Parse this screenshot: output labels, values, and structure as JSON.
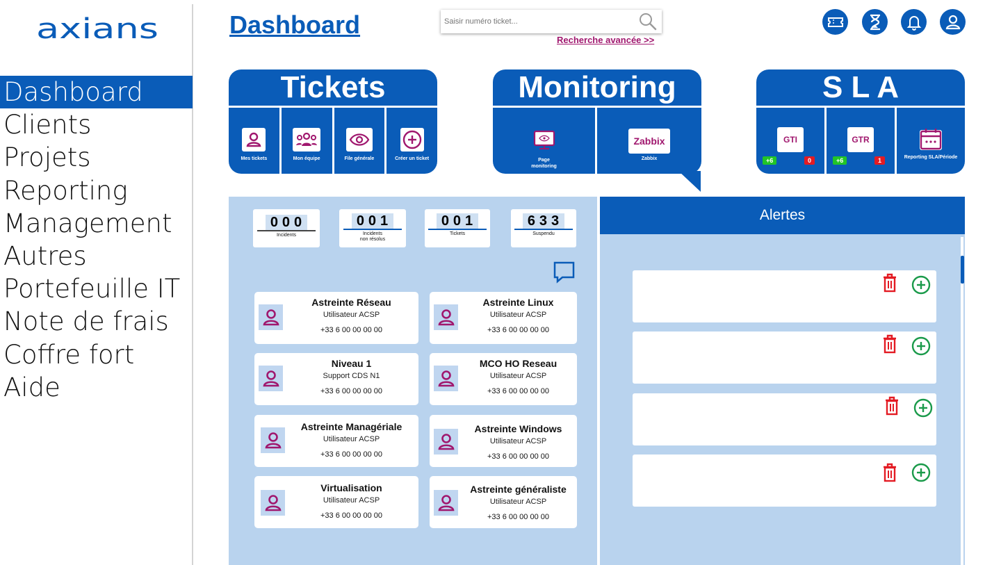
{
  "brand": {
    "logo_text": "axians",
    "primary_color": "#0a5cb8",
    "accent_color": "#a0176e"
  },
  "sidebar": {
    "items": [
      {
        "label": "Dashboard",
        "active": true
      },
      {
        "label": "Clients"
      },
      {
        "label": "Projets"
      },
      {
        "label": "Reporting"
      },
      {
        "label": "Management"
      },
      {
        "label": "Autres"
      },
      {
        "label": "Portefeuille IT"
      },
      {
        "label": "Note de frais"
      },
      {
        "label": "Coffre fort"
      },
      {
        "label": "Aide"
      }
    ]
  },
  "header": {
    "title": "Dashboard",
    "search_placeholder": "Saisir numéro ticket...",
    "advanced_search": "Recherche avancée >>",
    "icons": [
      "ticket-icon",
      "hourglass-icon",
      "bell-icon",
      "user-icon"
    ]
  },
  "tickets": {
    "title": "Tickets",
    "tiles": [
      {
        "label": "Mes tickets",
        "icon": "user-icon"
      },
      {
        "label": "Mon équipe",
        "icon": "team-icon"
      },
      {
        "label": "File générale",
        "icon": "eye-icon"
      },
      {
        "label": "Créer un ticket",
        "icon": "plus-circle-icon"
      }
    ]
  },
  "monitoring": {
    "title": "Monitoring",
    "tiles": [
      {
        "label": "Page\nmonitoring",
        "icon": "monitor-icon"
      },
      {
        "label": "Zabbix",
        "button": "Zabbix"
      }
    ]
  },
  "sla": {
    "title": "S L A",
    "tiles": [
      {
        "label": "",
        "button": "GTI",
        "badge_green": "+6",
        "badge_red": "0"
      },
      {
        "label": "",
        "button": "GTR",
        "badge_green": "+6",
        "badge_red": "1"
      },
      {
        "label": "Reporting SLA/Période",
        "icon": "calendar-icon"
      }
    ]
  },
  "counters": [
    {
      "value": "000",
      "label": "Incidents",
      "line_color": "#444444"
    },
    {
      "value": "001",
      "label": "Incidents\nnon résolus",
      "line_color": "#0a5cb8"
    },
    {
      "value": "001",
      "label": "Tickets",
      "line_color": "#0a5cb8"
    },
    {
      "value": "633",
      "label": "Suspendu",
      "line_color": "#0a5cb8"
    }
  ],
  "contacts": [
    {
      "name": "Astreinte Réseau",
      "role": "Utilisateur ACSP",
      "phone": "+33 6 00 00 00 00"
    },
    {
      "name": "Astreinte Linux",
      "role": "Utilisateur ACSP",
      "phone": "+33 6 00 00 00 00"
    },
    {
      "name": "Niveau 1",
      "role": "Support CDS N1",
      "phone": "+33 6 00 00 00 00"
    },
    {
      "name": "MCO HO Reseau",
      "role": "Utilisateur ACSP",
      "phone": "+33 6 00 00 00 00"
    },
    {
      "name": "Astreinte Managériale",
      "role": "Utilisateur ACSP",
      "phone": "+33 6 00 00 00 00"
    },
    {
      "name": "Astreinte Windows",
      "role": "Utilisateur ACSP",
      "phone": "+33 6 00 00 00 00"
    },
    {
      "name": "Virtualisation",
      "role": "Utilisateur ACSP",
      "phone": "+33 6 00 00 00 00"
    },
    {
      "name": "Astreinte généraliste",
      "role": "Utilisateur ACSP",
      "phone": "+33 6 00 00 00 00"
    }
  ],
  "alerts": {
    "title": "Alertes",
    "items": [
      {},
      {},
      {},
      {}
    ]
  }
}
